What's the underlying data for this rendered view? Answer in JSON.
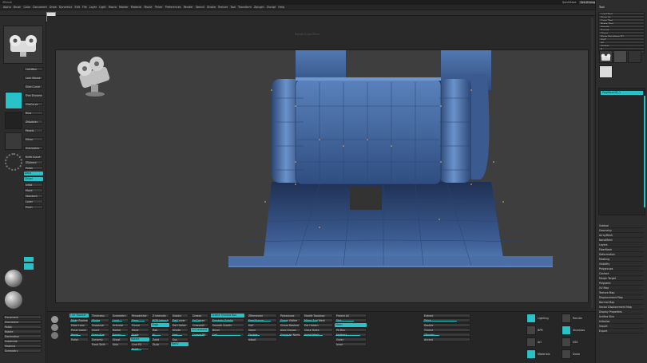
{
  "app": {
    "title": "ZBrush",
    "menu_items": [
      "Alpha",
      "Brush",
      "Color",
      "Document",
      "Draw",
      "Dynamics",
      "Edit",
      "File",
      "Layer",
      "Light",
      "Macro",
      "Marker",
      "Material",
      "Movie",
      "Picker",
      "Preferences",
      "Render",
      "Stencil",
      "Stroke",
      "Texture",
      "Tool",
      "Transform",
      "Zplugin",
      "Zscript",
      "Help"
    ]
  },
  "title_right": {
    "quicksave": "QuickSave",
    "seethrough": "See-through",
    "menus": "Menus",
    "default_script": "DefaultZScript"
  },
  "left_shelf": {
    "tool_items": [
      "LightBox",
      "Lazy Mouse",
      "Slice Curve",
      "Trim Dynamic",
      "ClipCurve",
      "Ring",
      "ZModeler",
      "Panels",
      "Mirror",
      "Zremesher",
      "Knife Curve",
      "ZSphere",
      "Polish",
      "Deco",
      "Chisel",
      "Inflat",
      "Move",
      "Standard",
      "Layer",
      "Pinch"
    ],
    "bottom_items": [
      "Dynamesh",
      "Zremesher",
      "Polish",
      "Rotate",
      "Decimation",
      "Subdivide",
      "Masking",
      "Symmetry"
    ],
    "materials": [
      "MatCap Red",
      "BasicMaterial"
    ],
    "color_label": "Gradient"
  },
  "canvas": {
    "header_text": "Rotate   Scale   Move"
  },
  "right_panel": {
    "title": "Tool",
    "rows": [
      "Load Tool",
      "Save As",
      "Copy Tool",
      "Paste Tool",
      "Import",
      "Export",
      "Clone",
      "Make PolyMesh3D",
      "GoZ",
      "All",
      "Visible",
      "R",
      "Lightbox > Tools"
    ],
    "sections": [
      "Subtool",
      "Geometry",
      "ArrayMesh",
      "NanoMesh",
      "Layers",
      "FiberMesh",
      "Deformation",
      "Masking",
      "Visibility",
      "Polygroups",
      "Contact",
      "Morph Target",
      "Polypaint",
      "UV Map",
      "Texture Map",
      "Displacement Map",
      "Normal Map",
      "Vector Displacement Map",
      "Display Properties",
      "Unified Skin",
      "Initialize",
      "Import",
      "Export"
    ],
    "subtool_name": "PolyMesh3D_1"
  },
  "bottom_panel": {
    "col1": [
      "Live Boolean",
      "Make Boolean Mesh",
      "Edge Loop",
      "Panel Loops",
      "Bevel",
      "Polish"
    ],
    "col2": [
      "Thickness",
      "Stroke",
      "Snapshot",
      "Insert",
      "Draw Size",
      "Dynamic",
      "Focal Shift"
    ],
    "col3": [
      "Symmetry",
      "Local",
      "Activate",
      "Radial",
      "Transp",
      "Ghost",
      "Solo"
    ],
    "col4": [
      "Perspective",
      "Floor",
      "Frame",
      "Move",
      "Scale",
      "Rotate",
      "Line Fill",
      "PolyF"
    ],
    "col5": [
      "Z Intensity",
      "RGB Intensity",
      "Mrgb",
      "Rgb",
      "M",
      "Zadd",
      "Zsub"
    ],
    "col6": [
      "Subdiv",
      "Del Lower",
      "Del Higher",
      "Divide",
      "Smt",
      "Suv",
      "ReUV"
    ],
    "col7": [
      "Crease",
      "UnCrease",
      "CreaseAll",
      "UnCreaseAll",
      "Crease PG"
    ],
    "col8": [
      "Create Shadow Box",
      "Dynamic Subdiv",
      "Smooth Subdiv",
      "Bevel",
      "Cell"
    ],
    "col9": [
      "ZRemesher",
      "KeepGroups",
      "Half",
      "Same",
      "Double",
      "Adapt"
    ],
    "col10": [
      "Polygroups",
      "Group Visible",
      "Group Masked",
      "Auto Groups",
      "Group by Normals"
    ],
    "col11": [
      "Modify Topology",
      "Mirror And Weld",
      "Del Hidden",
      "Close Holes",
      "Insert Mesh"
    ],
    "col12": [
      "Project All",
      "Dist",
      "Mean",
      "PA Blur",
      "Farthest",
      "Outer",
      "Inner"
    ],
    "col13": [
      "Extract",
      "Thick",
      "Double",
      "TCorne",
      "TBorder",
      "Accept"
    ],
    "right_items": [
      "Lighting",
      "Render",
      "BPR",
      "Shadows",
      "AO",
      "SSS",
      "Materials",
      "Draw"
    ]
  },
  "colors": {
    "accent": "#29c2c8",
    "mesh": "#4a6fa8",
    "viewport_bg": "#3e3e3e"
  }
}
